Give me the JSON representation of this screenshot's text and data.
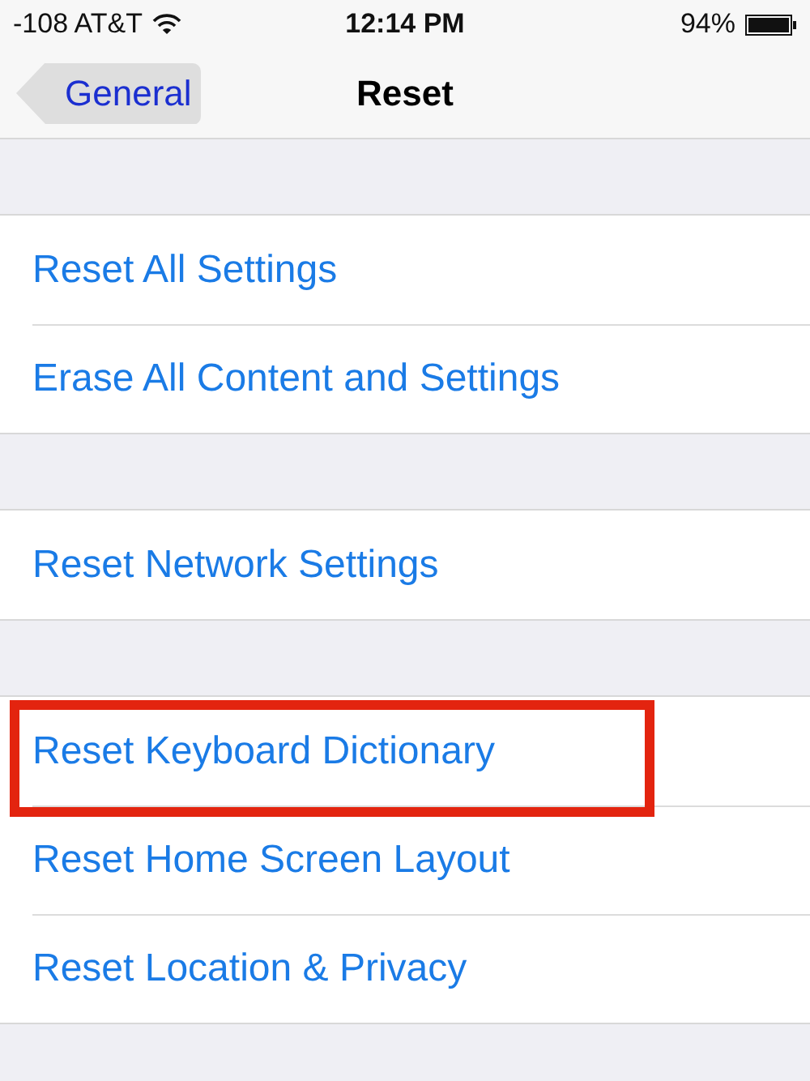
{
  "status_bar": {
    "carrier": "-108 AT&T",
    "time": "12:14 PM",
    "battery": "94%"
  },
  "nav_bar": {
    "back": "General",
    "title": "Reset"
  },
  "groups": [
    {
      "items": [
        {
          "label": "Reset All Settings",
          "highlighted": false
        },
        {
          "label": "Erase All Content and Settings",
          "highlighted": false
        }
      ]
    },
    {
      "items": [
        {
          "label": "Reset Network Settings",
          "highlighted": false
        }
      ]
    },
    {
      "items": [
        {
          "label": "Reset Keyboard Dictionary",
          "highlighted": true
        },
        {
          "label": "Reset Home Screen Layout",
          "highlighted": false
        },
        {
          "label": "Reset Location & Privacy",
          "highlighted": false
        }
      ]
    }
  ]
}
